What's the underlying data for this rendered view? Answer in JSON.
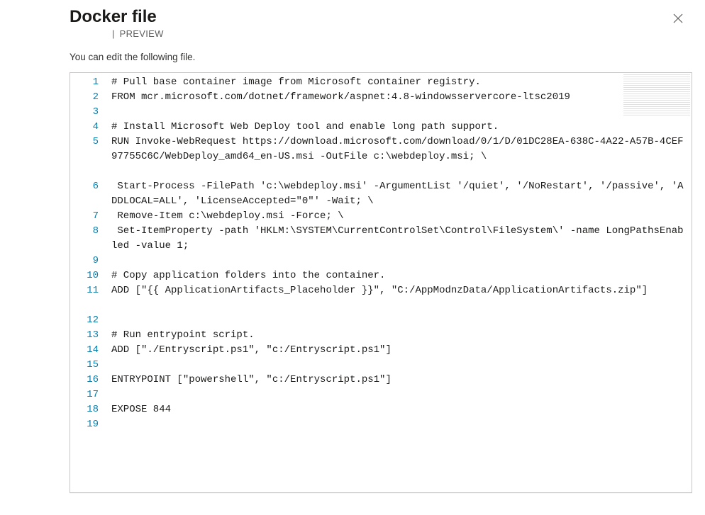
{
  "header": {
    "title": "Docker file",
    "preview_label": "PREVIEW"
  },
  "instruction": "You can edit the following file.",
  "editor": {
    "lines": [
      {
        "n": 1,
        "text": "# Pull base container image from Microsoft container registry."
      },
      {
        "n": 2,
        "text": "FROM mcr.microsoft.com/dotnet/framework/aspnet:4.8-windowsservercore-ltsc2019"
      },
      {
        "n": 3,
        "text": ""
      },
      {
        "n": 4,
        "text": "# Install Microsoft Web Deploy tool and enable long path support."
      },
      {
        "n": 5,
        "text": "RUN Invoke-WebRequest https://download.microsoft.com/download/0/1/D/01DC28EA-638C-4A22-A57B-4CEF97755C6C/WebDeploy_amd64_en-US.msi -OutFile c:\\webdeploy.msi; \\",
        "wrap": 3
      },
      {
        "n": 6,
        "text": " Start-Process -FilePath 'c:\\webdeploy.msi' -ArgumentList '/quiet', '/NoRestart', '/passive', 'ADDLOCAL=ALL', 'LicenseAccepted=\"0\"' -Wait; \\",
        "wrap": 2
      },
      {
        "n": 7,
        "text": " Remove-Item c:\\webdeploy.msi -Force; \\"
      },
      {
        "n": 8,
        "text": " Set-ItemProperty -path 'HKLM:\\SYSTEM\\CurrentControlSet\\Control\\FileSystem\\' -name LongPathsEnabled -value 1;",
        "wrap": 2
      },
      {
        "n": 9,
        "text": ""
      },
      {
        "n": 10,
        "text": "# Copy application folders into the container."
      },
      {
        "n": 11,
        "text": "ADD [\"{{ ApplicationArtifacts_Placeholder }}\", \"C:/AppModnzData/ApplicationArtifacts.zip\"]",
        "wrap": 2
      },
      {
        "n": 12,
        "text": ""
      },
      {
        "n": 13,
        "text": "# Run entrypoint script."
      },
      {
        "n": 14,
        "text": "ADD [\"./Entryscript.ps1\", \"c:/Entryscript.ps1\"]"
      },
      {
        "n": 15,
        "text": ""
      },
      {
        "n": 16,
        "text": "ENTRYPOINT [\"powershell\", \"c:/Entryscript.ps1\"]"
      },
      {
        "n": 17,
        "text": ""
      },
      {
        "n": 18,
        "text": "EXPOSE 844"
      },
      {
        "n": 19,
        "text": ""
      }
    ]
  }
}
